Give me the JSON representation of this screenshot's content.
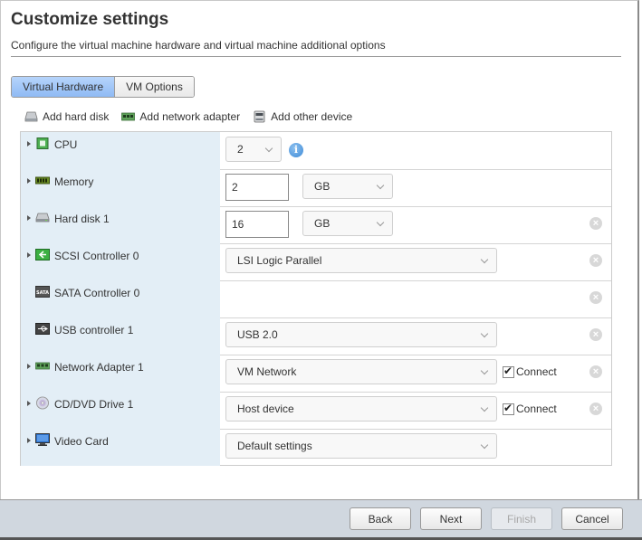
{
  "header": {
    "title": "Customize settings",
    "subtitle": "Configure the virtual machine hardware and virtual machine additional options"
  },
  "tabs": [
    {
      "label": "Virtual Hardware",
      "active": true
    },
    {
      "label": "VM Options",
      "active": false
    }
  ],
  "toolbar": {
    "add_hard_disk": "Add hard disk",
    "add_network_adapter": "Add network adapter",
    "add_other_device": "Add other device"
  },
  "devices": [
    {
      "label": "CPU",
      "icon": "cpu-icon",
      "expandable": true,
      "value": "2",
      "info": "i"
    },
    {
      "label": "Memory",
      "icon": "memory-icon",
      "expandable": true,
      "value": "2",
      "unit": "GB"
    },
    {
      "label": "Hard disk 1",
      "icon": "hard-disk-icon",
      "expandable": true,
      "value": "16",
      "unit": "GB",
      "removable": true
    },
    {
      "label": "SCSI Controller 0",
      "icon": "scsi-controller-icon",
      "expandable": true,
      "value": "LSI Logic Parallel",
      "removable": true
    },
    {
      "label": "SATA Controller 0",
      "icon": "sata-controller-icon",
      "expandable": false,
      "removable": true
    },
    {
      "label": "USB controller 1",
      "icon": "usb-icon",
      "expandable": false,
      "value": "USB 2.0",
      "removable": true
    },
    {
      "label": "Network Adapter 1",
      "icon": "network-adapter-icon",
      "expandable": true,
      "value": "VM Network",
      "connect_label": "Connect",
      "connected": true,
      "removable": true
    },
    {
      "label": "CD/DVD Drive 1",
      "icon": "cd-dvd-icon",
      "expandable": true,
      "value": "Host device",
      "connect_label": "Connect",
      "connected": true,
      "removable": true
    },
    {
      "label": "Video Card",
      "icon": "video-card-icon",
      "expandable": true,
      "value": "Default settings"
    }
  ],
  "footer": {
    "back": "Back",
    "next": "Next",
    "finish": "Finish",
    "cancel": "Cancel"
  },
  "remove_glyph": "×"
}
